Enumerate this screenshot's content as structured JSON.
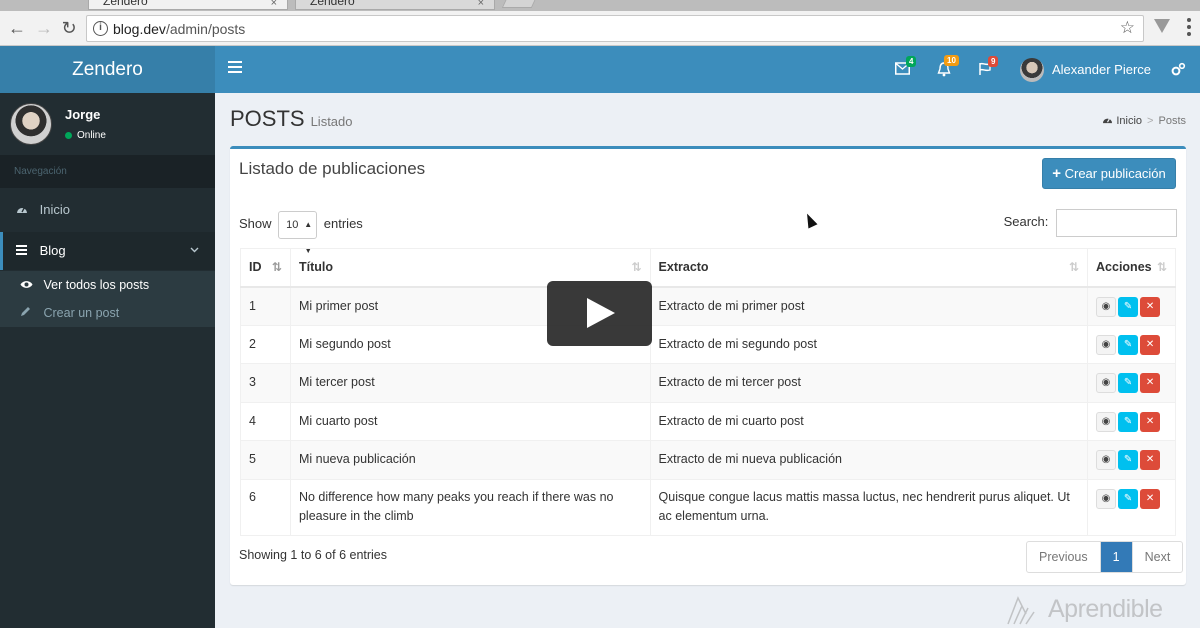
{
  "browser": {
    "tabs": [
      {
        "title": "Zendero",
        "close": "×"
      },
      {
        "title": "Zendero",
        "close": "×"
      }
    ],
    "url_host": "blog.dev",
    "url_path": "/admin/posts",
    "back_glyph": "←",
    "forward_glyph": "→",
    "reload_glyph": "↻",
    "star_glyph": "☆"
  },
  "header": {
    "logo": "Zendero",
    "messages_badge": "4",
    "notifications_badge": "10",
    "tasks_badge": "9",
    "user_name": "Alexander Pierce",
    "badge_colors": {
      "messages": "#00a65a",
      "notifications": "#f39c12",
      "tasks": "#dd4b39"
    }
  },
  "sidebar": {
    "user_name": "Jorge",
    "user_status": "Online",
    "nav_header": "Navegación",
    "items": [
      {
        "label": "Inicio",
        "icon": "dashboard-icon"
      },
      {
        "label": "Blog",
        "icon": "bars-icon",
        "expanded": true
      }
    ],
    "subitems": [
      {
        "label": "Ver todos los posts",
        "icon": "eye-icon",
        "active": true
      },
      {
        "label": "Crear un post",
        "icon": "pencil-icon",
        "active": false
      }
    ]
  },
  "page": {
    "title": "POSTS",
    "subtitle": "Listado",
    "breadcrumb": {
      "home": "Inicio",
      "current": "Posts",
      "separator": ">"
    }
  },
  "box": {
    "title": "Listado de publicaciones",
    "create_button": "Crear publicación",
    "show_label": "Show",
    "page_length": "10",
    "entries_label": "entries",
    "search_label": "Search:",
    "search_value": ""
  },
  "table": {
    "columns": [
      "ID",
      "Título",
      "Extracto",
      "Acciones"
    ],
    "rows": [
      {
        "id": "1",
        "title": "Mi primer post",
        "excerpt": "Extracto de mi primer post"
      },
      {
        "id": "2",
        "title": "Mi segundo post",
        "excerpt": "Extracto de mi segundo post"
      },
      {
        "id": "3",
        "title": "Mi tercer post",
        "excerpt": "Extracto de mi tercer post"
      },
      {
        "id": "4",
        "title": "Mi cuarto post",
        "excerpt": "Extracto de mi cuarto post"
      },
      {
        "id": "5",
        "title": "Mi nueva publicación",
        "excerpt": "Extracto de mi nueva publicación"
      },
      {
        "id": "6",
        "title": "No difference how many peaks you reach if there was no pleasure in the climb",
        "excerpt": "Quisque congue lacus mattis massa luctus, nec hendrerit purus aliquet. Ut ac elementum urna."
      }
    ]
  },
  "footer": {
    "info": "Showing 1 to 6 of 6 entries",
    "previous": "Previous",
    "current_page": "1",
    "next": "Next"
  },
  "watermark": "Aprendible",
  "colors": {
    "primary": "#3c8dbc",
    "sidebar": "#222d32",
    "danger": "#dd4b39",
    "info": "#00c0ef"
  }
}
